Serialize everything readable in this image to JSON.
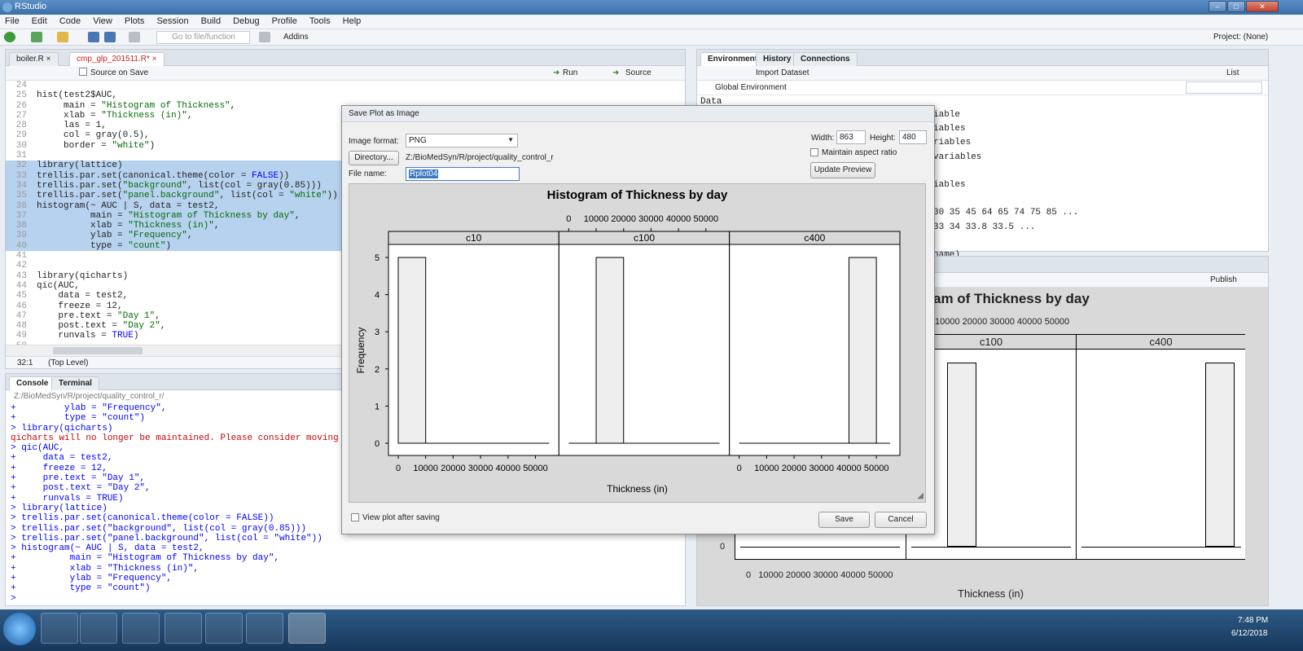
{
  "window": {
    "title": "RStudio",
    "controls": [
      "–",
      "□",
      "✕"
    ]
  },
  "menu": [
    "File",
    "Edit",
    "Code",
    "View",
    "Plots",
    "Session",
    "Build",
    "Debug",
    "Profile",
    "Tools",
    "Help"
  ],
  "toolbar": {
    "goto_placeholder": "Go to file/function",
    "addins": "Addins",
    "project": "Project: (None)"
  },
  "editor": {
    "tabs": [
      {
        "label": "boiler.R"
      },
      {
        "label": "cmp_glp_201511.R*"
      }
    ],
    "source_on_save": "Source on Save",
    "run": "Run",
    "source": "Source",
    "status_pos": "32:1",
    "status_scope": "(Top Level)",
    "lines": [
      {
        "n": "24",
        "t": ""
      },
      {
        "n": "25",
        "t": "hist(test2$AUC,"
      },
      {
        "n": "26",
        "t": "     main = \"Histogram of Thickness\","
      },
      {
        "n": "27",
        "t": "     xlab = \"Thickness (in)\","
      },
      {
        "n": "28",
        "t": "     las = 1,"
      },
      {
        "n": "29",
        "t": "     col = gray(0.5),"
      },
      {
        "n": "30",
        "t": "     border = \"white\")"
      },
      {
        "n": "31",
        "t": ""
      },
      {
        "n": "32",
        "t": "library(lattice)"
      },
      {
        "n": "33",
        "t": "trellis.par.set(canonical.theme(color = FALSE))"
      },
      {
        "n": "34",
        "t": "trellis.par.set(\"background\", list(col = gray(0.85)))"
      },
      {
        "n": "35",
        "t": "trellis.par.set(\"panel.background\", list(col = \"white\"))"
      },
      {
        "n": "36",
        "t": "histogram(~ AUC | S, data = test2,"
      },
      {
        "n": "37",
        "t": "          main = \"Histogram of Thickness by day\","
      },
      {
        "n": "38",
        "t": "          xlab = \"Thickness (in)\","
      },
      {
        "n": "39",
        "t": "          ylab = \"Frequency\","
      },
      {
        "n": "40",
        "t": "          type = \"count\")"
      },
      {
        "n": "41",
        "t": ""
      },
      {
        "n": "42",
        "t": ""
      },
      {
        "n": "43",
        "t": "library(qicharts)"
      },
      {
        "n": "44",
        "t": "qic(AUC,"
      },
      {
        "n": "45",
        "t": "    data = test2,"
      },
      {
        "n": "46",
        "t": "    freeze = 12,"
      },
      {
        "n": "47",
        "t": "    pre.text = \"Day 1\","
      },
      {
        "n": "48",
        "t": "    post.text = \"Day 2\","
      },
      {
        "n": "49",
        "t": "    runvals = TRUE)"
      },
      {
        "n": "50",
        "t": ""
      },
      {
        "n": "51",
        "t": ""
      }
    ]
  },
  "console": {
    "tabs": [
      {
        "label": "Console"
      },
      {
        "label": "Terminal"
      }
    ],
    "path": "Z:/BioMedSyn/R/project/quality_control_r/",
    "lines": [
      {
        "t": "+         ylab = \"Frequency\",",
        "red": false
      },
      {
        "t": "+         type = \"count\")",
        "red": false
      },
      {
        "t": "> library(qicharts)",
        "red": false
      },
      {
        "t": "qicharts will no longer be maintained. Please consider moving",
        "red": true
      },
      {
        "t": "> qic(AUC,",
        "red": false
      },
      {
        "t": "+     data = test2,",
        "red": false
      },
      {
        "t": "+     freeze = 12,",
        "red": false
      },
      {
        "t": "+     pre.text = \"Day 1\",",
        "red": false
      },
      {
        "t": "+     post.text = \"Day 2\",",
        "red": false
      },
      {
        "t": "+     runvals = TRUE)",
        "red": false
      },
      {
        "t": "> library(lattice)",
        "red": false
      },
      {
        "t": "> trellis.par.set(canonical.theme(color = FALSE))",
        "red": false
      },
      {
        "t": "> trellis.par.set(\"background\", list(col = gray(0.85)))",
        "red": false
      },
      {
        "t": "> trellis.par.set(\"panel.background\", list(col = \"white\"))",
        "red": false
      },
      {
        "t": "> histogram(~ AUC | S, data = test2,",
        "red": false
      },
      {
        "t": "+          main = \"Histogram of Thickness by day\",",
        "red": false
      },
      {
        "t": "+          xlab = \"Thickness (in)\",",
        "red": false
      },
      {
        "t": "+          ylab = \"Frequency\",",
        "red": false
      },
      {
        "t": "+          type = \"count\")",
        "red": false
      },
      {
        "t": "> ",
        "red": false
      }
    ]
  },
  "environment": {
    "tabs": [
      {
        "label": "Environment"
      },
      {
        "label": "History"
      },
      {
        "label": "Connections"
      }
    ],
    "import_dataset": "Import Dataset",
    "list_view": "List",
    "scope": "Global Environment",
    "section": "Data",
    "rows": [
      "iable",
      "iables",
      "riables",
      "variables",
      "",
      "iables",
      "",
      "30 35 45 64 65 74 75 85 ...",
      "33 34 33.8 33.5 ...",
      "",
      "name)"
    ]
  },
  "plots_pane": {
    "publish": "Publish",
    "title_fragment": "am of Thickness by day",
    "top_axis": "10000 20000 30000 40000 50000",
    "panels": [
      "c100",
      "c400"
    ],
    "zero_label": "0",
    "bottom_axis": "0   10000 20000 30000 40000 50000",
    "xlabel": "Thickness (in)"
  },
  "dialog": {
    "title": "Save Plot as Image",
    "image_format_label": "Image format:",
    "image_format_value": "PNG",
    "directory_button": "Directory...",
    "directory_path": "Z:/BioMedSyn/R/project/quality_control_r",
    "file_name_label": "File name:",
    "file_name_value": "Rplot04",
    "width_label": "Width:",
    "width_value": "863",
    "height_label": "Height:",
    "height_value": "480",
    "maintain_aspect": "Maintain aspect ratio",
    "update_preview": "Update Preview",
    "view_after_saving": "View plot after saving",
    "save": "Save",
    "cancel": "Cancel"
  },
  "chart_data": {
    "type": "bar",
    "title": "Histogram of Thickness by day",
    "xlabel": "Thickness (in)",
    "ylabel": "Frequency",
    "ylim": [
      0,
      5
    ],
    "yticks": [
      0,
      1,
      2,
      3,
      4,
      5
    ],
    "xticks": [
      "0",
      "10000",
      "20000",
      "30000",
      "40000",
      "50000"
    ],
    "panels": [
      {
        "name": "c10",
        "bars": [
          {
            "x0": 0,
            "x1": 10000,
            "count": 5
          }
        ]
      },
      {
        "name": "c100",
        "bars": [
          {
            "x0": 10000,
            "x1": 20000,
            "count": 5
          }
        ]
      },
      {
        "name": "c400",
        "bars": [
          {
            "x0": 40000,
            "x1": 50000,
            "count": 5
          }
        ]
      }
    ]
  },
  "taskbar": {
    "time": "7:48 PM",
    "date": "6/12/2018"
  }
}
